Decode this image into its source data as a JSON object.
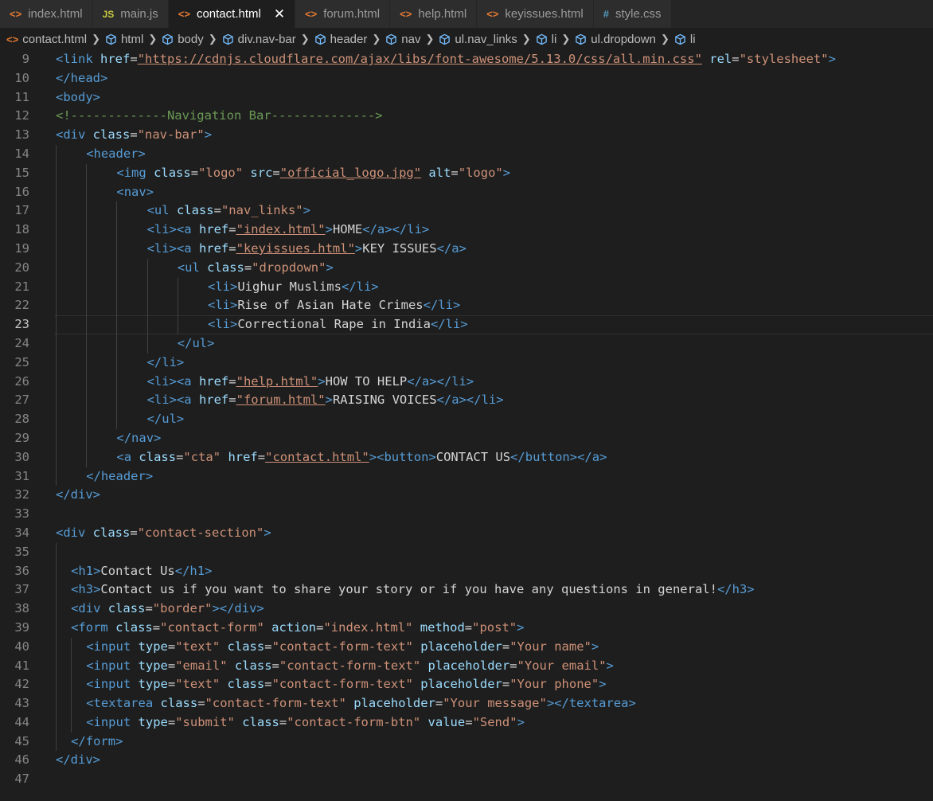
{
  "tabs": [
    {
      "label": "index.html",
      "icon": "html-file-icon",
      "active": false
    },
    {
      "label": "main.js",
      "icon": "js-file-icon",
      "active": false
    },
    {
      "label": "contact.html",
      "icon": "html-file-icon",
      "active": true
    },
    {
      "label": "forum.html",
      "icon": "html-file-icon",
      "active": false
    },
    {
      "label": "help.html",
      "icon": "html-file-icon",
      "active": false
    },
    {
      "label": "keyissues.html",
      "icon": "html-file-icon",
      "active": false
    },
    {
      "label": "style.css",
      "icon": "css-file-icon",
      "active": false
    }
  ],
  "breadcrumb": [
    "contact.html",
    "html",
    "body",
    "div.nav-bar",
    "header",
    "nav",
    "ul.nav_links",
    "li",
    "ul.dropdown",
    "li"
  ],
  "editor": {
    "current_line": 23,
    "lines": [
      {
        "n": "9",
        "indent": 0,
        "tokens": [
          [
            "t",
            "<link"
          ],
          [
            "x",
            " "
          ],
          [
            "a",
            "href"
          ],
          [
            "x",
            "="
          ],
          [
            "u",
            "\"https://cdnjs.cloudflare.com/ajax/libs/font-awesome/5.13.0/css/all.min.css\""
          ],
          [
            "x",
            " "
          ],
          [
            "a",
            "rel"
          ],
          [
            "x",
            "="
          ],
          [
            "s",
            "\"stylesheet\""
          ],
          [
            "t",
            ">"
          ]
        ]
      },
      {
        "n": "10",
        "indent": 0,
        "tokens": [
          [
            "t",
            "</head>"
          ]
        ]
      },
      {
        "n": "11",
        "indent": 0,
        "tokens": [
          [
            "t",
            "<body>"
          ]
        ]
      },
      {
        "n": "12",
        "indent": 0,
        "tokens": [
          [
            "c",
            "<!-------------Navigation Bar-------------->"
          ]
        ]
      },
      {
        "n": "13",
        "indent": 0,
        "tokens": [
          [
            "t",
            "<div"
          ],
          [
            "x",
            " "
          ],
          [
            "a",
            "class"
          ],
          [
            "x",
            "="
          ],
          [
            "s",
            "\"nav-bar\""
          ],
          [
            "t",
            ">"
          ]
        ]
      },
      {
        "n": "14",
        "indent": 4,
        "tokens": [
          [
            "t",
            "<header>"
          ]
        ]
      },
      {
        "n": "15",
        "indent": 8,
        "tokens": [
          [
            "t",
            "<img"
          ],
          [
            "x",
            " "
          ],
          [
            "a",
            "class"
          ],
          [
            "x",
            "="
          ],
          [
            "s",
            "\"logo\""
          ],
          [
            "x",
            " "
          ],
          [
            "a",
            "src"
          ],
          [
            "x",
            "="
          ],
          [
            "u",
            "\"official_logo.jpg\""
          ],
          [
            "x",
            " "
          ],
          [
            "a",
            "alt"
          ],
          [
            "x",
            "="
          ],
          [
            "s",
            "\"logo\""
          ],
          [
            "t",
            ">"
          ]
        ]
      },
      {
        "n": "16",
        "indent": 8,
        "tokens": [
          [
            "t",
            "<nav>"
          ]
        ]
      },
      {
        "n": "17",
        "indent": 12,
        "tokens": [
          [
            "t",
            "<ul"
          ],
          [
            "x",
            " "
          ],
          [
            "a",
            "class"
          ],
          [
            "x",
            "="
          ],
          [
            "s",
            "\"nav_links\""
          ],
          [
            "t",
            ">"
          ]
        ]
      },
      {
        "n": "18",
        "indent": 12,
        "tokens": [
          [
            "t",
            "<li><a"
          ],
          [
            "x",
            " "
          ],
          [
            "a",
            "href"
          ],
          [
            "x",
            "="
          ],
          [
            "u",
            "\"index.html\""
          ],
          [
            "t",
            ">"
          ],
          [
            "x",
            "HOME"
          ],
          [
            "t",
            "</a></li>"
          ]
        ]
      },
      {
        "n": "19",
        "indent": 12,
        "tokens": [
          [
            "t",
            "<li><a"
          ],
          [
            "x",
            " "
          ],
          [
            "a",
            "href"
          ],
          [
            "x",
            "="
          ],
          [
            "u",
            "\"keyissues.html\""
          ],
          [
            "t",
            ">"
          ],
          [
            "x",
            "KEY ISSUES"
          ],
          [
            "t",
            "</a>"
          ]
        ]
      },
      {
        "n": "20",
        "indent": 16,
        "tokens": [
          [
            "t",
            "<ul"
          ],
          [
            "x",
            " "
          ],
          [
            "a",
            "class"
          ],
          [
            "x",
            "="
          ],
          [
            "s",
            "\"dropdown\""
          ],
          [
            "t",
            ">"
          ]
        ]
      },
      {
        "n": "21",
        "indent": 20,
        "tokens": [
          [
            "t",
            "<li>"
          ],
          [
            "x",
            "Uighur Muslims"
          ],
          [
            "t",
            "</li>"
          ]
        ]
      },
      {
        "n": "22",
        "indent": 20,
        "tokens": [
          [
            "t",
            "<li>"
          ],
          [
            "x",
            "Rise of Asian Hate Crimes"
          ],
          [
            "t",
            "</li>"
          ]
        ]
      },
      {
        "n": "23",
        "indent": 20,
        "tokens": [
          [
            "t",
            "<li>"
          ],
          [
            "x",
            "Correctional Rape in India"
          ],
          [
            "t",
            "</li>"
          ]
        ]
      },
      {
        "n": "24",
        "indent": 16,
        "tokens": [
          [
            "t",
            "</ul>"
          ]
        ]
      },
      {
        "n": "25",
        "indent": 12,
        "tokens": [
          [
            "t",
            "</li>"
          ]
        ]
      },
      {
        "n": "26",
        "indent": 12,
        "tokens": [
          [
            "t",
            "<li><a"
          ],
          [
            "x",
            " "
          ],
          [
            "a",
            "href"
          ],
          [
            "x",
            "="
          ],
          [
            "u",
            "\"help.html\""
          ],
          [
            "t",
            ">"
          ],
          [
            "x",
            "HOW TO HELP"
          ],
          [
            "t",
            "</a></li>"
          ]
        ]
      },
      {
        "n": "27",
        "indent": 12,
        "tokens": [
          [
            "t",
            "<li><a"
          ],
          [
            "x",
            " "
          ],
          [
            "a",
            "href"
          ],
          [
            "x",
            "="
          ],
          [
            "u",
            "\"forum.html\""
          ],
          [
            "t",
            ">"
          ],
          [
            "x",
            "RAISING VOICES"
          ],
          [
            "t",
            "</a></li>"
          ]
        ]
      },
      {
        "n": "28",
        "indent": 12,
        "tokens": [
          [
            "t",
            "</ul>"
          ]
        ]
      },
      {
        "n": "29",
        "indent": 8,
        "tokens": [
          [
            "t",
            "</nav>"
          ]
        ]
      },
      {
        "n": "30",
        "indent": 8,
        "tokens": [
          [
            "t",
            "<a"
          ],
          [
            "x",
            " "
          ],
          [
            "a",
            "class"
          ],
          [
            "x",
            "="
          ],
          [
            "s",
            "\"cta\""
          ],
          [
            "x",
            " "
          ],
          [
            "a",
            "href"
          ],
          [
            "x",
            "="
          ],
          [
            "u",
            "\"contact.html\""
          ],
          [
            "t",
            ">"
          ],
          [
            "t",
            "<button>"
          ],
          [
            "x",
            "CONTACT US"
          ],
          [
            "t",
            "</button></a>"
          ]
        ]
      },
      {
        "n": "31",
        "indent": 4,
        "tokens": [
          [
            "t",
            "</header>"
          ]
        ]
      },
      {
        "n": "32",
        "indent": 0,
        "tokens": [
          [
            "t",
            "</div>"
          ]
        ]
      },
      {
        "n": "33",
        "indent": 0,
        "tokens": []
      },
      {
        "n": "34",
        "indent": 0,
        "tokens": [
          [
            "t",
            "<div"
          ],
          [
            "x",
            " "
          ],
          [
            "a",
            "class"
          ],
          [
            "x",
            "="
          ],
          [
            "s",
            "\"contact-section\""
          ],
          [
            "t",
            ">"
          ]
        ]
      },
      {
        "n": "35",
        "indent": 0,
        "tokens": []
      },
      {
        "n": "36",
        "indent": 2,
        "tokens": [
          [
            "t",
            "<h1>"
          ],
          [
            "x",
            "Contact Us"
          ],
          [
            "t",
            "</h1>"
          ]
        ]
      },
      {
        "n": "37",
        "indent": 2,
        "tokens": [
          [
            "t",
            "<h3>"
          ],
          [
            "x",
            "Contact us if you want to share your story or if you have any questions in general!"
          ],
          [
            "t",
            "</h3>"
          ]
        ]
      },
      {
        "n": "38",
        "indent": 2,
        "tokens": [
          [
            "t",
            "<div"
          ],
          [
            "x",
            " "
          ],
          [
            "a",
            "class"
          ],
          [
            "x",
            "="
          ],
          [
            "s",
            "\"border\""
          ],
          [
            "t",
            "></div>"
          ]
        ]
      },
      {
        "n": "39",
        "indent": 2,
        "tokens": [
          [
            "t",
            "<form"
          ],
          [
            "x",
            " "
          ],
          [
            "a",
            "class"
          ],
          [
            "x",
            "="
          ],
          [
            "s",
            "\"contact-form\""
          ],
          [
            "x",
            " "
          ],
          [
            "a",
            "action"
          ],
          [
            "x",
            "="
          ],
          [
            "s",
            "\"index.html\""
          ],
          [
            "x",
            " "
          ],
          [
            "a",
            "method"
          ],
          [
            "x",
            "="
          ],
          [
            "s",
            "\"post\""
          ],
          [
            "t",
            ">"
          ]
        ]
      },
      {
        "n": "40",
        "indent": 4,
        "tokens": [
          [
            "t",
            "<input"
          ],
          [
            "x",
            " "
          ],
          [
            "a",
            "type"
          ],
          [
            "x",
            "="
          ],
          [
            "s",
            "\"text\""
          ],
          [
            "x",
            " "
          ],
          [
            "a",
            "class"
          ],
          [
            "x",
            "="
          ],
          [
            "s",
            "\"contact-form-text\""
          ],
          [
            "x",
            " "
          ],
          [
            "a",
            "placeholder"
          ],
          [
            "x",
            "="
          ],
          [
            "s",
            "\"Your name\""
          ],
          [
            "t",
            ">"
          ]
        ]
      },
      {
        "n": "41",
        "indent": 4,
        "tokens": [
          [
            "t",
            "<input"
          ],
          [
            "x",
            " "
          ],
          [
            "a",
            "type"
          ],
          [
            "x",
            "="
          ],
          [
            "s",
            "\"email\""
          ],
          [
            "x",
            " "
          ],
          [
            "a",
            "class"
          ],
          [
            "x",
            "="
          ],
          [
            "s",
            "\"contact-form-text\""
          ],
          [
            "x",
            " "
          ],
          [
            "a",
            "placeholder"
          ],
          [
            "x",
            "="
          ],
          [
            "s",
            "\"Your email\""
          ],
          [
            "t",
            ">"
          ]
        ]
      },
      {
        "n": "42",
        "indent": 4,
        "tokens": [
          [
            "t",
            "<input"
          ],
          [
            "x",
            " "
          ],
          [
            "a",
            "type"
          ],
          [
            "x",
            "="
          ],
          [
            "s",
            "\"text\""
          ],
          [
            "x",
            " "
          ],
          [
            "a",
            "class"
          ],
          [
            "x",
            "="
          ],
          [
            "s",
            "\"contact-form-text\""
          ],
          [
            "x",
            " "
          ],
          [
            "a",
            "placeholder"
          ],
          [
            "x",
            "="
          ],
          [
            "s",
            "\"Your phone\""
          ],
          [
            "t",
            ">"
          ]
        ]
      },
      {
        "n": "43",
        "indent": 4,
        "tokens": [
          [
            "t",
            "<textarea"
          ],
          [
            "x",
            " "
          ],
          [
            "a",
            "class"
          ],
          [
            "x",
            "="
          ],
          [
            "s",
            "\"contact-form-text\""
          ],
          [
            "x",
            " "
          ],
          [
            "a",
            "placeholder"
          ],
          [
            "x",
            "="
          ],
          [
            "s",
            "\"Your message\""
          ],
          [
            "t",
            "></textarea>"
          ]
        ]
      },
      {
        "n": "44",
        "indent": 4,
        "tokens": [
          [
            "t",
            "<input"
          ],
          [
            "x",
            " "
          ],
          [
            "a",
            "type"
          ],
          [
            "x",
            "="
          ],
          [
            "s",
            "\"submit\""
          ],
          [
            "x",
            " "
          ],
          [
            "a",
            "class"
          ],
          [
            "x",
            "="
          ],
          [
            "s",
            "\"contact-form-btn\""
          ],
          [
            "x",
            " "
          ],
          [
            "a",
            "value"
          ],
          [
            "x",
            "="
          ],
          [
            "s",
            "\"Send\""
          ],
          [
            "t",
            ">"
          ]
        ]
      },
      {
        "n": "45",
        "indent": 2,
        "tokens": [
          [
            "t",
            "</form>"
          ]
        ]
      },
      {
        "n": "46",
        "indent": 0,
        "tokens": [
          [
            "t",
            "</div>"
          ]
        ]
      },
      {
        "n": "47",
        "indent": 0,
        "tokens": []
      }
    ]
  }
}
